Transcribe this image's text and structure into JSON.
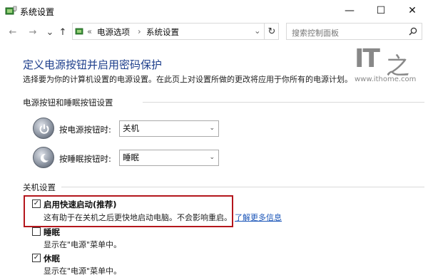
{
  "window": {
    "title": "系统设置",
    "minimize_glyph": "—",
    "maximize_glyph": "☐",
    "close_glyph": "✕"
  },
  "nav": {
    "back_glyph": "←",
    "forward_glyph": "→",
    "recent_glyph": "⌄",
    "up_glyph": "↑",
    "refresh_glyph": "↻",
    "dropdown_glyph": "⌄"
  },
  "address": {
    "overflow": "«",
    "crumb1": "电源选项",
    "separator": "›",
    "crumb2": "系统设置"
  },
  "search": {
    "placeholder": "搜索控制面板"
  },
  "page": {
    "title": "定义电源按钮并启用密码保护",
    "description": "选择要为你的计算机设置的电源设置。在此页上对设置所做的更改将应用于你所有的电源计划。"
  },
  "power_section": {
    "heading": "电源按钮和睡眠按钮设置",
    "power_button_label": "按电源按钮时:",
    "power_button_value": "关机",
    "sleep_button_label": "按睡眠按钮时:",
    "sleep_button_value": "睡眠",
    "select_arrow": "⌄"
  },
  "shutdown_section": {
    "heading": "关机设置",
    "fast_startup": {
      "checked": true,
      "check_glyph": "✓",
      "label": "启用快速启动(推荐)",
      "description": "这有助于在关机之后更快地启动电脑。不会影响重启。",
      "learn_more": "了解更多信息"
    },
    "sleep": {
      "checked": false,
      "check_glyph": "",
      "label": "睡眠",
      "description": "显示在\"电源\"菜单中。"
    },
    "hibernate": {
      "checked": true,
      "check_glyph": "✓",
      "label": "休眠",
      "description": "显示在\"电源\"菜单中。"
    }
  },
  "watermark": {
    "brand": "IT",
    "brand_char": "之",
    "url": "www.ithome.com"
  },
  "colors": {
    "heading_blue": "#1e3f8c",
    "link_blue": "#1a55b8",
    "highlight_red": "#b4161c"
  }
}
